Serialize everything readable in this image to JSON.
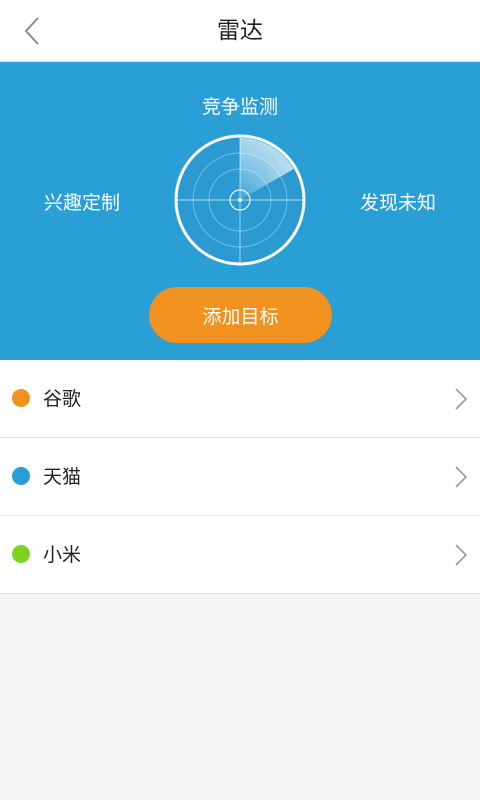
{
  "header": {
    "title": "雷达"
  },
  "radar": {
    "top_label": "竞争监测",
    "left_label": "兴趣定制",
    "right_label": "发现未知",
    "add_button": "添加目标"
  },
  "targets": [
    {
      "label": "谷歌",
      "color": "#f19220"
    },
    {
      "label": "天猫",
      "color": "#299fd6"
    },
    {
      "label": "小米",
      "color": "#7ed321"
    }
  ],
  "colors": {
    "accent": "#299fd6",
    "button": "#f19220"
  }
}
